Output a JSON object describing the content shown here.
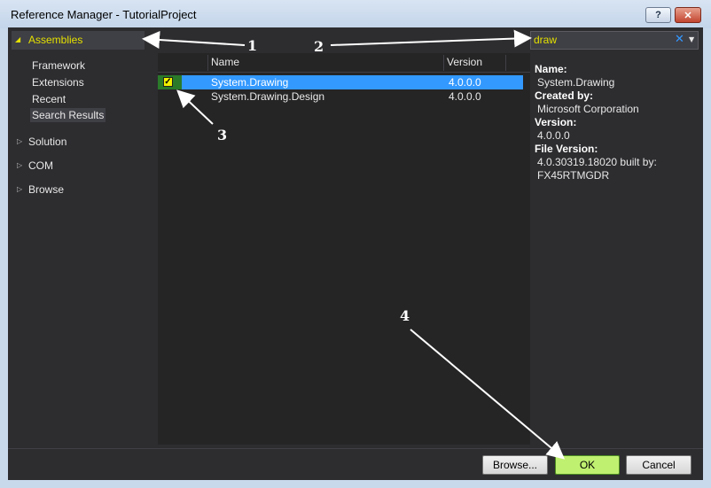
{
  "window": {
    "title": "Reference Manager - TutorialProject",
    "help_glyph": "?",
    "close_glyph": "✕"
  },
  "sidebar": {
    "header": "Assemblies",
    "items": [
      {
        "label": "Framework"
      },
      {
        "label": "Extensions"
      },
      {
        "label": "Recent"
      },
      {
        "label": "Search Results"
      }
    ],
    "groups": [
      {
        "label": "Solution"
      },
      {
        "label": "COM"
      },
      {
        "label": "Browse"
      }
    ]
  },
  "search": {
    "value": "draw",
    "clear_glyph": "✕",
    "dropdown_glyph": "▼"
  },
  "table": {
    "columns": [
      "Name",
      "Version"
    ],
    "rows": [
      {
        "name": "System.Drawing",
        "version": "4.0.0.0",
        "checked": true,
        "selected": true
      },
      {
        "name": "System.Drawing.Design",
        "version": "4.0.0.0",
        "checked": false,
        "selected": false
      }
    ]
  },
  "details": {
    "name_label": "Name:",
    "name_value": "System.Drawing",
    "created_label": "Created by:",
    "created_value": "Microsoft Corporation",
    "version_label": "Version:",
    "version_value": "4.0.0.0",
    "file_version_label": "File Version:",
    "file_version_value_1": "4.0.30319.18020 built by:",
    "file_version_value_2": "FX45RTMGDR"
  },
  "buttons": {
    "browse": "Browse...",
    "ok": "OK",
    "cancel": "Cancel"
  },
  "annotations": [
    "1",
    "2",
    "3",
    "4"
  ],
  "colors": {
    "accent_yellow": "#e3e000",
    "selection_blue": "#3399ff",
    "ok_green": "#c0f070"
  }
}
